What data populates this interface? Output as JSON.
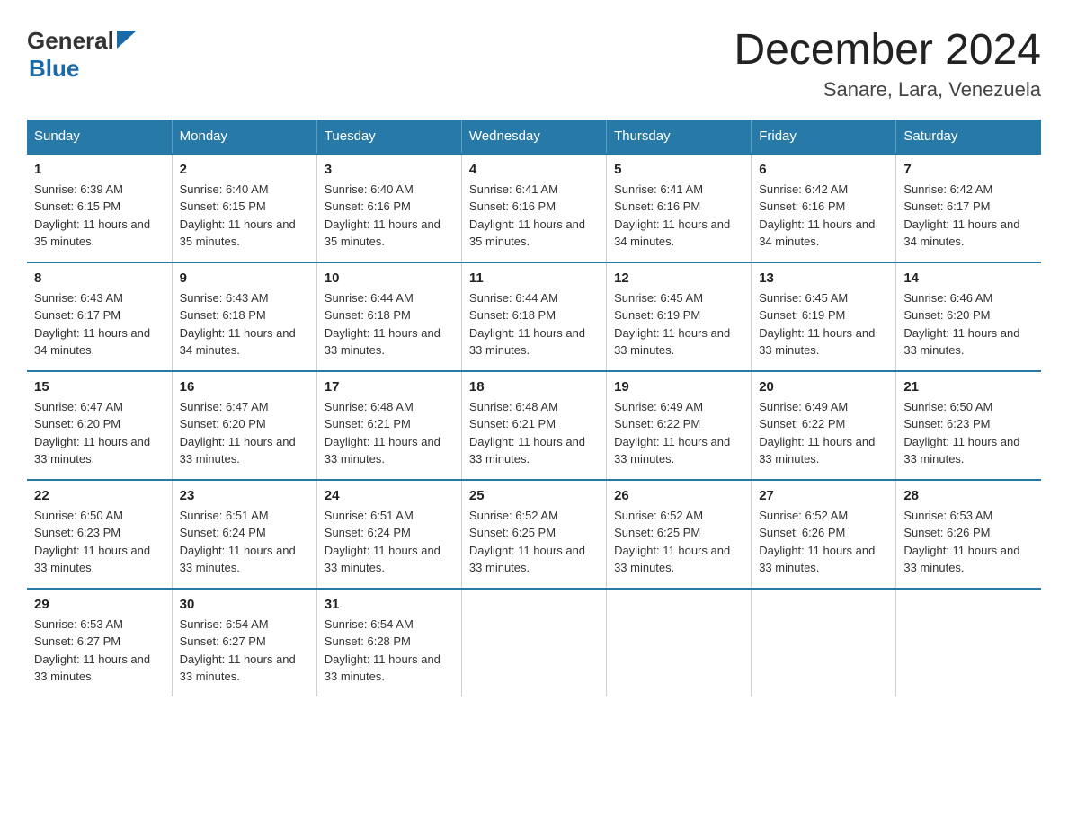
{
  "header": {
    "title": "December 2024",
    "subtitle": "Sanare, Lara, Venezuela",
    "logo_general": "General",
    "logo_blue": "Blue"
  },
  "days_of_week": [
    "Sunday",
    "Monday",
    "Tuesday",
    "Wednesday",
    "Thursday",
    "Friday",
    "Saturday"
  ],
  "weeks": [
    [
      {
        "num": "1",
        "sunrise": "6:39 AM",
        "sunset": "6:15 PM",
        "daylight": "11 hours and 35 minutes."
      },
      {
        "num": "2",
        "sunrise": "6:40 AM",
        "sunset": "6:15 PM",
        "daylight": "11 hours and 35 minutes."
      },
      {
        "num": "3",
        "sunrise": "6:40 AM",
        "sunset": "6:16 PM",
        "daylight": "11 hours and 35 minutes."
      },
      {
        "num": "4",
        "sunrise": "6:41 AM",
        "sunset": "6:16 PM",
        "daylight": "11 hours and 35 minutes."
      },
      {
        "num": "5",
        "sunrise": "6:41 AM",
        "sunset": "6:16 PM",
        "daylight": "11 hours and 34 minutes."
      },
      {
        "num": "6",
        "sunrise": "6:42 AM",
        "sunset": "6:16 PM",
        "daylight": "11 hours and 34 minutes."
      },
      {
        "num": "7",
        "sunrise": "6:42 AM",
        "sunset": "6:17 PM",
        "daylight": "11 hours and 34 minutes."
      }
    ],
    [
      {
        "num": "8",
        "sunrise": "6:43 AM",
        "sunset": "6:17 PM",
        "daylight": "11 hours and 34 minutes."
      },
      {
        "num": "9",
        "sunrise": "6:43 AM",
        "sunset": "6:18 PM",
        "daylight": "11 hours and 34 minutes."
      },
      {
        "num": "10",
        "sunrise": "6:44 AM",
        "sunset": "6:18 PM",
        "daylight": "11 hours and 33 minutes."
      },
      {
        "num": "11",
        "sunrise": "6:44 AM",
        "sunset": "6:18 PM",
        "daylight": "11 hours and 33 minutes."
      },
      {
        "num": "12",
        "sunrise": "6:45 AM",
        "sunset": "6:19 PM",
        "daylight": "11 hours and 33 minutes."
      },
      {
        "num": "13",
        "sunrise": "6:45 AM",
        "sunset": "6:19 PM",
        "daylight": "11 hours and 33 minutes."
      },
      {
        "num": "14",
        "sunrise": "6:46 AM",
        "sunset": "6:20 PM",
        "daylight": "11 hours and 33 minutes."
      }
    ],
    [
      {
        "num": "15",
        "sunrise": "6:47 AM",
        "sunset": "6:20 PM",
        "daylight": "11 hours and 33 minutes."
      },
      {
        "num": "16",
        "sunrise": "6:47 AM",
        "sunset": "6:20 PM",
        "daylight": "11 hours and 33 minutes."
      },
      {
        "num": "17",
        "sunrise": "6:48 AM",
        "sunset": "6:21 PM",
        "daylight": "11 hours and 33 minutes."
      },
      {
        "num": "18",
        "sunrise": "6:48 AM",
        "sunset": "6:21 PM",
        "daylight": "11 hours and 33 minutes."
      },
      {
        "num": "19",
        "sunrise": "6:49 AM",
        "sunset": "6:22 PM",
        "daylight": "11 hours and 33 minutes."
      },
      {
        "num": "20",
        "sunrise": "6:49 AM",
        "sunset": "6:22 PM",
        "daylight": "11 hours and 33 minutes."
      },
      {
        "num": "21",
        "sunrise": "6:50 AM",
        "sunset": "6:23 PM",
        "daylight": "11 hours and 33 minutes."
      }
    ],
    [
      {
        "num": "22",
        "sunrise": "6:50 AM",
        "sunset": "6:23 PM",
        "daylight": "11 hours and 33 minutes."
      },
      {
        "num": "23",
        "sunrise": "6:51 AM",
        "sunset": "6:24 PM",
        "daylight": "11 hours and 33 minutes."
      },
      {
        "num": "24",
        "sunrise": "6:51 AM",
        "sunset": "6:24 PM",
        "daylight": "11 hours and 33 minutes."
      },
      {
        "num": "25",
        "sunrise": "6:52 AM",
        "sunset": "6:25 PM",
        "daylight": "11 hours and 33 minutes."
      },
      {
        "num": "26",
        "sunrise": "6:52 AM",
        "sunset": "6:25 PM",
        "daylight": "11 hours and 33 minutes."
      },
      {
        "num": "27",
        "sunrise": "6:52 AM",
        "sunset": "6:26 PM",
        "daylight": "11 hours and 33 minutes."
      },
      {
        "num": "28",
        "sunrise": "6:53 AM",
        "sunset": "6:26 PM",
        "daylight": "11 hours and 33 minutes."
      }
    ],
    [
      {
        "num": "29",
        "sunrise": "6:53 AM",
        "sunset": "6:27 PM",
        "daylight": "11 hours and 33 minutes."
      },
      {
        "num": "30",
        "sunrise": "6:54 AM",
        "sunset": "6:27 PM",
        "daylight": "11 hours and 33 minutes."
      },
      {
        "num": "31",
        "sunrise": "6:54 AM",
        "sunset": "6:28 PM",
        "daylight": "11 hours and 33 minutes."
      },
      null,
      null,
      null,
      null
    ]
  ]
}
